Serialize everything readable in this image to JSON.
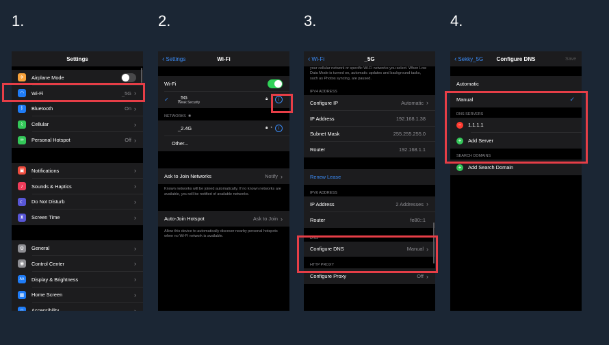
{
  "steps": [
    "1.",
    "2.",
    "3.",
    "4."
  ],
  "phone1": {
    "title": "Settings",
    "group1": [
      {
        "label": "Airplane Mode",
        "icon": "airplane-icon",
        "color": "#f7a23b",
        "glyph": "✈"
      },
      {
        "label": "Wi-Fi",
        "value": "_5G",
        "icon": "wifi-icon",
        "color": "#1f7cf6",
        "glyph": "◠"
      },
      {
        "label": "Bluetooth",
        "value": "On",
        "icon": "bluetooth-icon",
        "color": "#1f7cf6",
        "glyph": "ᛒ"
      },
      {
        "label": "Cellular",
        "icon": "cellular-icon",
        "color": "#34c759",
        "glyph": "⌇"
      },
      {
        "label": "Personal Hotspot",
        "value": "Off",
        "icon": "hotspot-icon",
        "color": "#34c759",
        "glyph": "∞"
      }
    ],
    "group2": [
      {
        "label": "Notifications",
        "icon": "notifications-icon",
        "color": "#ee4c3e",
        "glyph": "▣"
      },
      {
        "label": "Sounds & Haptics",
        "icon": "sounds-icon",
        "color": "#ee3c5a",
        "glyph": "♪"
      },
      {
        "label": "Do Not Disturb",
        "icon": "moon-icon",
        "color": "#5856d6",
        "glyph": "☾"
      },
      {
        "label": "Screen Time",
        "icon": "hourglass-icon",
        "color": "#5856d6",
        "glyph": "⧗"
      }
    ],
    "group3": [
      {
        "label": "General",
        "icon": "gear-icon",
        "color": "#8e8e93",
        "glyph": "⚙"
      },
      {
        "label": "Control Center",
        "icon": "control-center-icon",
        "color": "#8e8e93",
        "glyph": "◉"
      },
      {
        "label": "Display & Brightness",
        "icon": "display-icon",
        "color": "#1f7cf6",
        "glyph": "AA"
      },
      {
        "label": "Home Screen",
        "icon": "home-screen-icon",
        "color": "#1f7cf6",
        "glyph": "▦"
      },
      {
        "label": "Accessibility",
        "icon": "accessibility-icon",
        "color": "#1f7cf6",
        "glyph": "☺"
      }
    ]
  },
  "phone2": {
    "back": "Settings",
    "title": "Wi-Fi",
    "wifi_label": "Wi-Fi",
    "network_name": "_5G",
    "network_sub": "Weak Security",
    "networks_header": "NETWORKS",
    "network2": "_2.4G",
    "other": "Other...",
    "ask_label": "Ask to Join Networks",
    "ask_value": "Notify",
    "ask_note": "Known networks will be joined automatically. If no known networks are available, you will be notified of available networks.",
    "auto_label": "Auto-Join Hotspot",
    "auto_value": "Ask to Join",
    "auto_note": "Allow this device to automatically discover nearby personal hotspots when no Wi-Fi network is available."
  },
  "phone3": {
    "back": "Wi-Fi",
    "title": "_5G",
    "top_note": "your cellular network or specific Wi-Fi networks you select. When Low Data Mode is turned on, automatic updates and background tasks, such as Photos syncing, are paused.",
    "ipv4_header": "IPV4 ADDRESS",
    "configure_ip": "Configure IP",
    "configure_ip_value": "Automatic",
    "ip_label": "IP Address",
    "ip_value": "192.168.1.38",
    "subnet_label": "Subnet Mask",
    "subnet_value": "255.255.255.0",
    "router_label": "Router",
    "router_value": "192.168.1.1",
    "renew": "Renew Lease",
    "ipv6_header": "IPV6 ADDRESS",
    "ip6_label": "IP Address",
    "ip6_value": "2 Addresses",
    "router6_label": "Router",
    "router6_value": "fe80::1",
    "dns_header": "DNS",
    "dns_label": "Configure DNS",
    "dns_value": "Manual",
    "proxy_header": "HTTP PROXY",
    "proxy_label": "Configure Proxy",
    "proxy_value": "Off"
  },
  "phone4": {
    "back": "Sekky_5G",
    "title": "Configure DNS",
    "save": "Save",
    "automatic": "Automatic",
    "manual": "Manual",
    "dns_servers_header": "DNS SERVERS",
    "server": "1.1.1.1",
    "add_server": "Add Server",
    "search_header": "SEARCH DOMAINS",
    "add_search": "Add Search Domain"
  }
}
